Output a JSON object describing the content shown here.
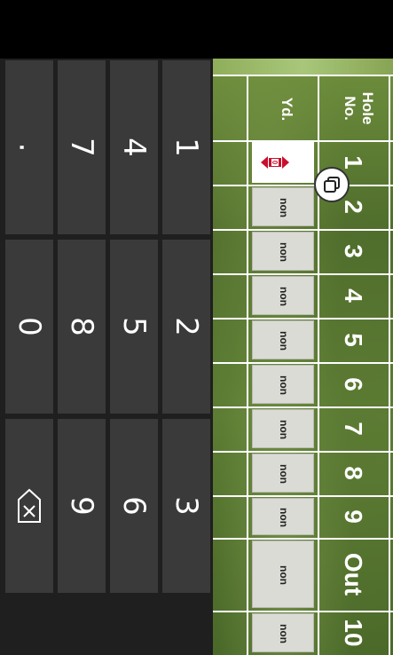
{
  "header": {
    "hole_label": "Hole\nNo.",
    "yd_label": "Yd."
  },
  "holes": [
    {
      "num": "1",
      "yd": ""
    },
    {
      "num": "2",
      "yd": "non"
    },
    {
      "num": "3",
      "yd": "non"
    },
    {
      "num": "4",
      "yd": "non"
    },
    {
      "num": "5",
      "yd": "non"
    },
    {
      "num": "6",
      "yd": "non"
    },
    {
      "num": "7",
      "yd": "non"
    },
    {
      "num": "8",
      "yd": "non"
    },
    {
      "num": "9",
      "yd": "non"
    },
    {
      "num": "Out",
      "yd": "non"
    },
    {
      "num": "10",
      "yd": "non"
    }
  ],
  "active_value": "0",
  "keypad": {
    "keys": [
      "1",
      "2",
      "3",
      "4",
      "5",
      "6",
      "7",
      "8",
      "9",
      ".",
      "0"
    ],
    "backspace_icon": "backspace-icon"
  },
  "colors": {
    "keypad_bg": "#1f1f1f",
    "key_bg": "#3a3a3a",
    "cell_bg": "#dadbd5",
    "accent_red": "#c8102e"
  }
}
